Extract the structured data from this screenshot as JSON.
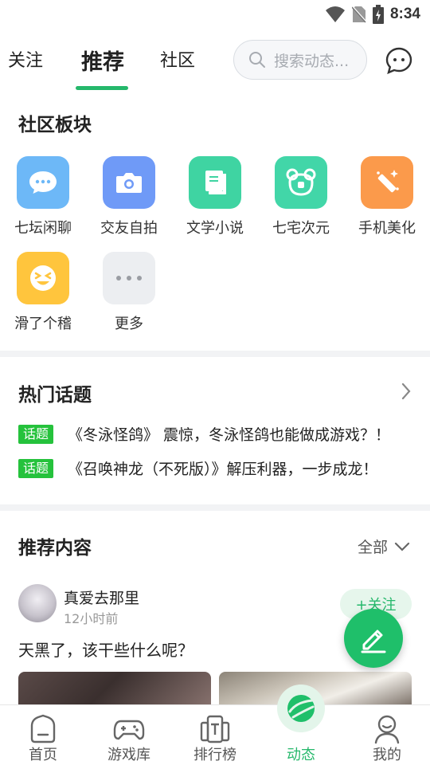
{
  "status_bar": {
    "time": "8:34"
  },
  "top_tabs": [
    {
      "label": "关注",
      "active": false
    },
    {
      "label": "推荐",
      "active": true
    },
    {
      "label": "社区",
      "active": false
    }
  ],
  "search": {
    "placeholder": "搜索动态..."
  },
  "community": {
    "title": "社区板块",
    "categories": [
      {
        "label": "七坛闲聊",
        "icon": "chat-bubble-icon",
        "color": "#6db8f7"
      },
      {
        "label": "交友自拍",
        "icon": "camera-icon",
        "color": "#6f9af7"
      },
      {
        "label": "文学小说",
        "icon": "book-icon",
        "color": "#3fd4a2"
      },
      {
        "label": "七宅次元",
        "icon": "bear-icon",
        "color": "#42d6a8"
      },
      {
        "label": "手机美化",
        "icon": "brush-icon",
        "color": "#fb9a4b"
      },
      {
        "label": "滑了个稽",
        "icon": "funny-face-icon",
        "color": "#ffc53d"
      },
      {
        "label": "更多",
        "icon": "more-dots-icon",
        "color": "#eceef1"
      }
    ]
  },
  "hot_topics": {
    "title": "热门话题",
    "badge": "话题",
    "items": [
      "《冬泳怪鸽》 震惊，冬泳怪鸽也能做成游戏？！",
      "《召唤神龙（不死版）》解压利器，一步成龙！"
    ]
  },
  "recommended": {
    "title": "推荐内容",
    "filter": "全部",
    "post": {
      "user": "真爱去那里",
      "time": "12小时前",
      "follow_label": "+关注",
      "text": "天黑了，该干些什么呢？"
    }
  },
  "bottom_nav": [
    {
      "label": "首页",
      "icon": "home-icon",
      "active": false
    },
    {
      "label": "游戏库",
      "icon": "gamepad-icon",
      "active": false
    },
    {
      "label": "排行榜",
      "icon": "ranking-icon",
      "active": false
    },
    {
      "label": "动态",
      "icon": "planet-icon",
      "active": true
    },
    {
      "label": "我的",
      "icon": "profile-icon",
      "active": false
    }
  ],
  "colors": {
    "accent": "#25b86b",
    "topic_badge": "#25c23c"
  }
}
